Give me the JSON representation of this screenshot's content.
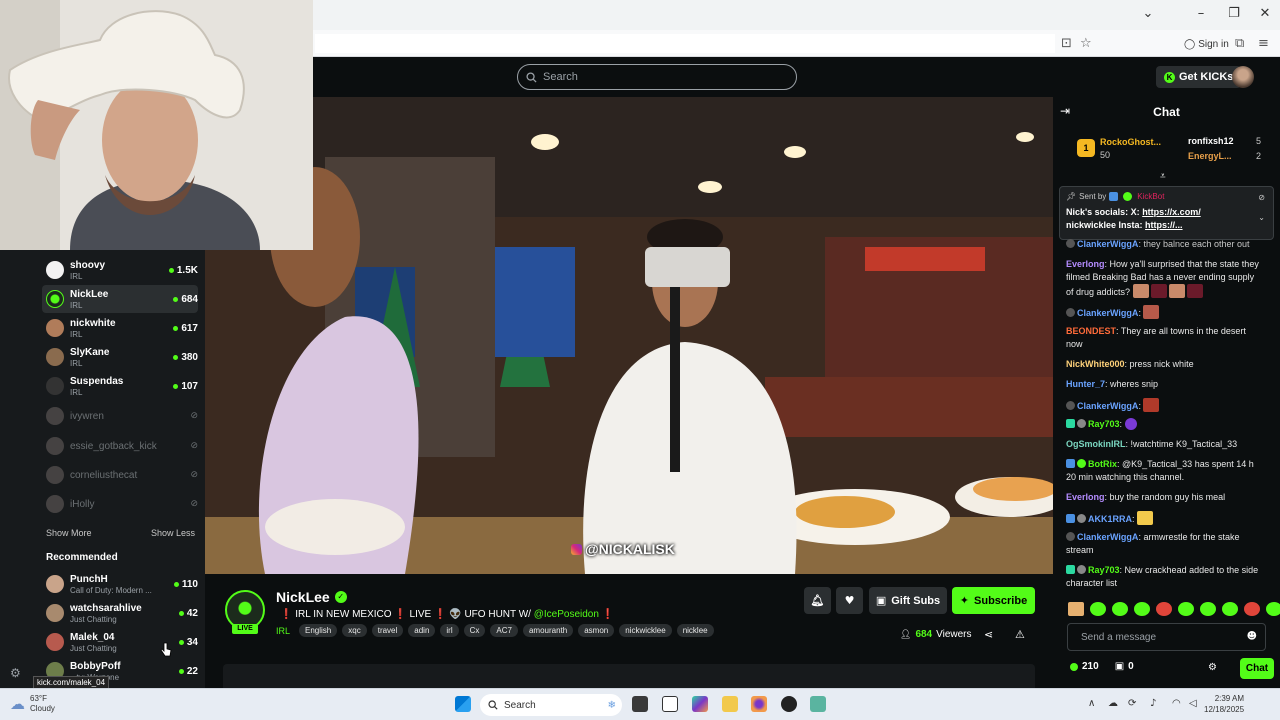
{
  "browser": {
    "sign_in": "Sign in"
  },
  "header": {
    "search_placeholder": "Search",
    "get_kicks": "Get KICKs"
  },
  "sidebar": {
    "following": [
      {
        "name": "shoovy",
        "category": "IRL",
        "viewers": "1.5K",
        "live": true
      },
      {
        "name": "NickLee",
        "category": "IRL",
        "viewers": "684",
        "live": true
      },
      {
        "name": "nickwhite",
        "category": "IRL",
        "viewers": "617",
        "live": true
      },
      {
        "name": "SlyKane",
        "category": "IRL",
        "viewers": "380",
        "live": true
      },
      {
        "name": "Suspendas",
        "category": "IRL",
        "viewers": "107",
        "live": true
      },
      {
        "name": "ivywren",
        "live": false
      },
      {
        "name": "essie_gotback_kick",
        "live": false
      },
      {
        "name": "corneliusthecat",
        "live": false
      },
      {
        "name": "iHolly",
        "live": false
      }
    ],
    "show_more": "Show More",
    "show_less": "Show Less",
    "recommended_title": "Recommended",
    "recommended": [
      {
        "name": "PunchH",
        "category": "Call of Duty: Modern ...",
        "viewers": "110"
      },
      {
        "name": "watchsarahlive",
        "category": "Just Chatting",
        "viewers": "42"
      },
      {
        "name": "Malek_04",
        "category": "Just Chatting",
        "viewers": "34"
      },
      {
        "name": "BobbyPoff",
        "category": "...ty: Warzone",
        "viewers": "22"
      }
    ],
    "link_tooltip": "kick.com/malek_04"
  },
  "video": {
    "overlay_tag": "@NICKALISK"
  },
  "stream": {
    "streamer": "NickLee",
    "live_label": "LIVE",
    "title_prefix": "❗ IRL IN NEW MEXICO ❗ LIVE ❗ 👽 UFO HUNT W/ ",
    "title_mention": "@IcePoseidon",
    "title_suffix": " ❗",
    "category": "IRL",
    "tags": [
      "English",
      "xqc",
      "travel",
      "adin",
      "irl",
      "Cx",
      "AC7",
      "amouranth",
      "asmon",
      "nickwicklee",
      "nicklee"
    ],
    "gift_subs": "Gift Subs",
    "subscribe": "Subscribe",
    "viewer_count": "684",
    "viewers_label": "Viewers"
  },
  "chat": {
    "title": "Chat",
    "leaderboard": {
      "first": {
        "rank": "1",
        "name": "RockoGhost...",
        "count": "50"
      },
      "second": {
        "name": "ronfixsh12",
        "count": "5"
      },
      "third": {
        "name": "EnergyL...",
        "count": "2"
      }
    },
    "pinned": {
      "sent_by": "Sent by",
      "bot": "KickBot",
      "line1_prefix": "Nick's socials: X: ",
      "line1_link": "https://x.com/",
      "line2_prefix": "nickwicklee Insta: ",
      "line2_link": "https://..."
    },
    "messages": [
      {
        "user": "ClankerWiggA",
        "text": "they balnce each other out"
      },
      {
        "user": "Everlong",
        "text": "How ya'll surprised that the state they filmed Breaking Bad has a never ending supply of drug addicts?"
      },
      {
        "user": "ClankerWiggA",
        "text": ""
      },
      {
        "user": "BEONDEST",
        "text": "They are all towns in the desert now"
      },
      {
        "user": "NickWhite000",
        "text": "press nick white"
      },
      {
        "user": "Hunter_7",
        "text": "wheres snip"
      },
      {
        "user": "ClankerWiggA",
        "text": ""
      },
      {
        "user": "Ray703",
        "text": ""
      },
      {
        "user": "OgSmokinIRL",
        "text": "!watchtime K9_Tactical_33"
      },
      {
        "user": "BotRix",
        "text": "@K9_Tactical_33 has spent 14 h 20 min watching this channel."
      },
      {
        "user": "Everlong",
        "text": "buy the random guy his meal"
      },
      {
        "user": "AKK1RRA",
        "text": ""
      },
      {
        "user": "ClankerWiggA",
        "text": "armwrestle for the stake stream"
      },
      {
        "user": "Ray703",
        "text": "New crackhead added to the side character list"
      }
    ],
    "input_placeholder": "Send a message",
    "kicks_balance": "210",
    "gift_count": "0",
    "send_label": "Chat"
  },
  "taskbar": {
    "temp": "63°F",
    "weather": "Cloudy",
    "search": "Search",
    "time": "2:39 AM",
    "date": "12/18/2025"
  }
}
